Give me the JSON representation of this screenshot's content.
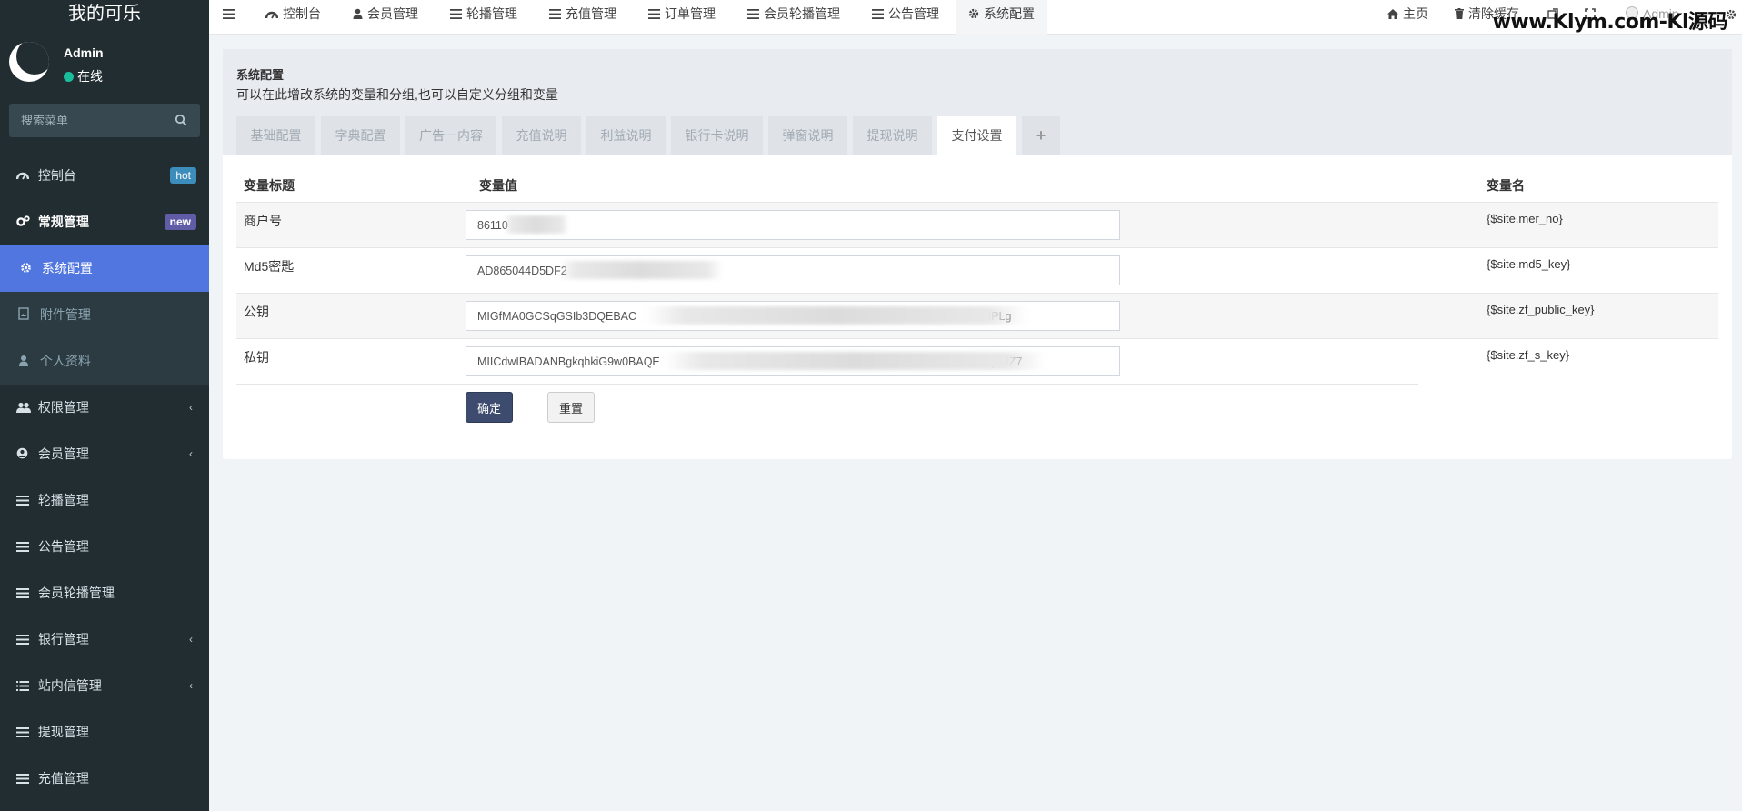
{
  "app": {
    "title": "我的可乐"
  },
  "user": {
    "name": "Admin",
    "status": "在线"
  },
  "search": {
    "placeholder": "搜索菜单"
  },
  "sidebar": {
    "items": [
      {
        "label": "控制台",
        "icon": "dashboard-icon",
        "badge": "hot",
        "badge_color": "#3c8dbc"
      },
      {
        "label": "常规管理",
        "icon": "cogs-icon",
        "badge": "new",
        "badge_color": "#605ca8"
      },
      {
        "label": "系统配置",
        "icon": "gear-icon"
      },
      {
        "label": "附件管理",
        "icon": "file-image-icon"
      },
      {
        "label": "个人资料",
        "icon": "user-icon"
      },
      {
        "label": "权限管理",
        "icon": "users-icon"
      },
      {
        "label": "会员管理",
        "icon": "user-circle-icon"
      },
      {
        "label": "轮播管理",
        "icon": "list-icon"
      },
      {
        "label": "公告管理",
        "icon": "list-icon"
      },
      {
        "label": "会员轮播管理",
        "icon": "list-icon"
      },
      {
        "label": "银行管理",
        "icon": "list-icon"
      },
      {
        "label": "站内信管理",
        "icon": "list-ul-icon"
      },
      {
        "label": "提现管理",
        "icon": "list-icon"
      },
      {
        "label": "充值管理",
        "icon": "list-icon"
      }
    ]
  },
  "topnav": {
    "tabs": [
      "控制台",
      "会员管理",
      "轮播管理",
      "充值管理",
      "订单管理",
      "会员轮播管理",
      "公告管理",
      "系统配置"
    ],
    "home": "主页",
    "clear_cache": "清除缓存",
    "admin": "Admin",
    "watermark": "www.Klym.com-Kl源码"
  },
  "panel": {
    "title": "系统配置",
    "description": "可以在此增改系统的变量和分组,也可以自定义分组和变量",
    "tabs": [
      "基础配置",
      "字典配置",
      "广告一内容",
      "充值说明",
      "利益说明",
      "银行卡说明",
      "弹窗说明",
      "提现说明",
      "支付设置"
    ],
    "add_tab": "+"
  },
  "table": {
    "headers": [
      "变量标题",
      "变量值",
      "变量名"
    ],
    "rows": [
      {
        "label": "商户号",
        "value": "86110",
        "var": "{$site.mer_no}"
      },
      {
        "label": "Md5密匙",
        "value": "AD865044D5DF2",
        "var": "{$site.md5_key}"
      },
      {
        "label": "公钥",
        "value": "MIGfMA0GCSqGSIb3DQEBAC                                                                                         PWo3lGU7VFlPLg",
        "var": "{$site.zf_public_key}"
      },
      {
        "label": "私钥",
        "value": "MIICdwIBADANBgkqhkiG9w0BAQE                                                                                       kzMJdak9ajeUZ7",
        "var": "{$site.zf_s_key}"
      }
    ]
  },
  "buttons": {
    "confirm": "确定",
    "reset": "重置"
  },
  "colors": {
    "sidebar_bg": "#222d32",
    "active": "#5176e0",
    "confirm_btn": "#3d4b6e",
    "status_online": "#1abc9c"
  }
}
